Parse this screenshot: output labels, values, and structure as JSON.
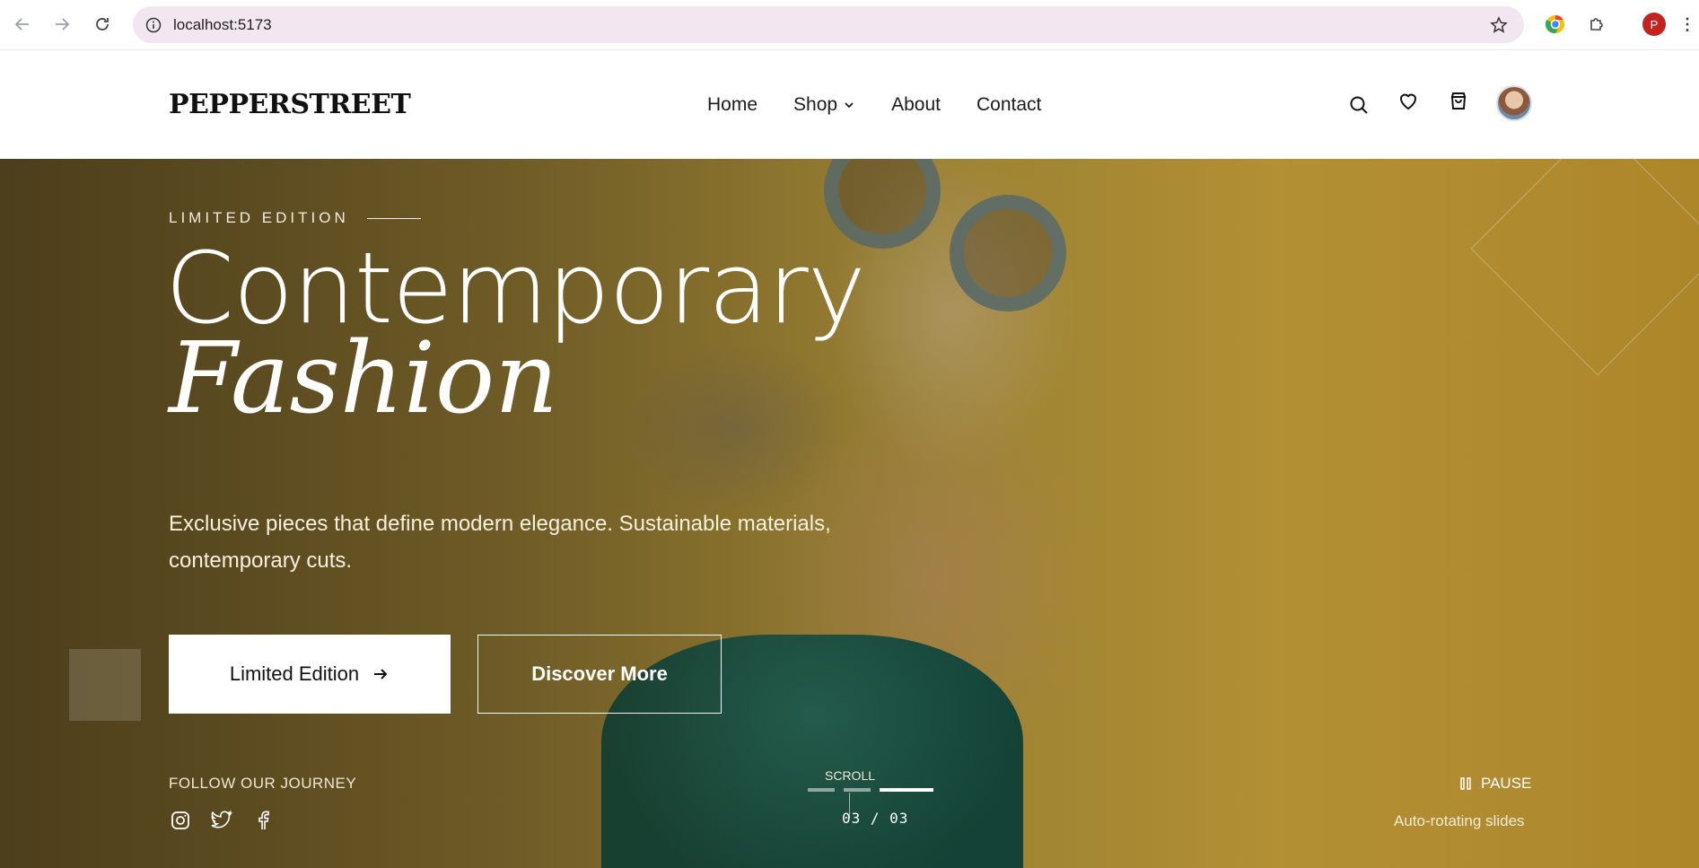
{
  "browser": {
    "url": "localhost:5173",
    "profile_initial": "P"
  },
  "header": {
    "logo": "PEPPERSTREET",
    "nav": [
      {
        "label": "Home"
      },
      {
        "label": "Shop"
      },
      {
        "label": "About"
      },
      {
        "label": "Contact"
      }
    ]
  },
  "hero": {
    "eyebrow": "LIMITED EDITION",
    "title_line1": "Contemporary",
    "title_line2": "Fashion",
    "subtitle": "Exclusive pieces that define modern elegance. Sustainable materials, contemporary cuts.",
    "primary_button": "Limited Edition",
    "secondary_button": "Discover More",
    "follow_label": "FOLLOW OUR JOURNEY",
    "scroll_label": "SCROLL",
    "counter": "03 / 03",
    "pause_label": "PAUSE",
    "auto_label": "Auto-rotating slides"
  },
  "colors": {
    "hero_bg": "#b89a3c",
    "dress": "#1f6b5e",
    "url_bar": "#f2e6f1",
    "profile": "#c5221f"
  }
}
